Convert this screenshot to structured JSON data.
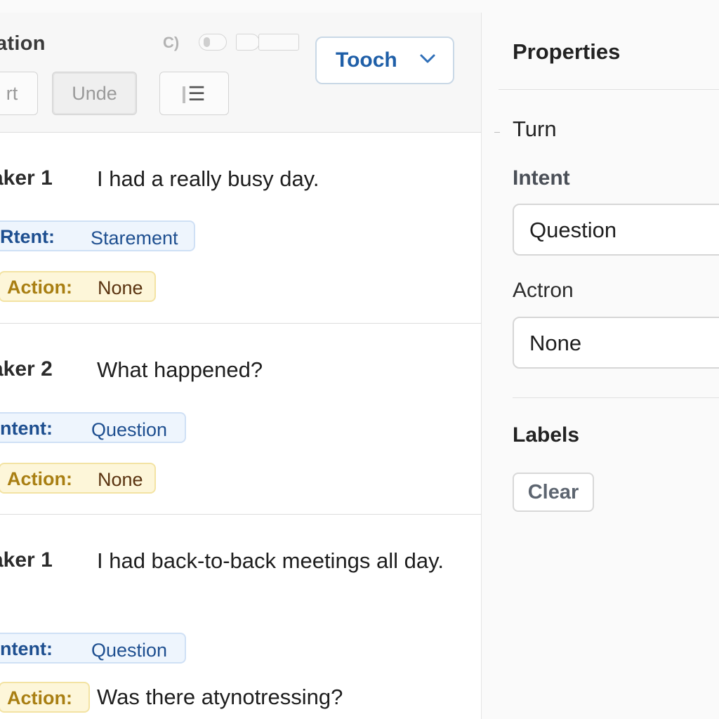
{
  "toolbar": {
    "title": "ation",
    "c_label": "C)",
    "start_label": "rt",
    "undo_label": "Unde",
    "view_icon": "list-icon",
    "dropdown_label": "Tooch"
  },
  "turns": [
    {
      "speaker": "aker 1",
      "utterance": "I had a really busy day.",
      "intent_key": "Rtent:",
      "intent_value": "Starement",
      "action_key": "Action:",
      "action_value": "None"
    },
    {
      "speaker": "aker 2",
      "utterance": "What happened?",
      "intent_key": "ntent:",
      "intent_value": "Question",
      "action_key": "Action:",
      "action_value": "None"
    },
    {
      "speaker": "aker 1",
      "utterance": "I had back-to-back meetings all day.",
      "intent_key": "ntent:",
      "intent_value": "Question",
      "action_key": "Action:",
      "action_value": "Was there atynotressing?"
    }
  ],
  "properties": {
    "title": "Properties",
    "turn_label": "Turn",
    "intent_label": "Intent",
    "intent_value": "Question",
    "action_label": "Actron",
    "action_value": "None",
    "labels_heading": "Labels",
    "clear_label": "Clear"
  },
  "colors": {
    "accent": "#1f5fa8",
    "intent_bg": "#eef5fd",
    "action_bg": "#fdf6d9",
    "action_key": "#a97f13"
  }
}
